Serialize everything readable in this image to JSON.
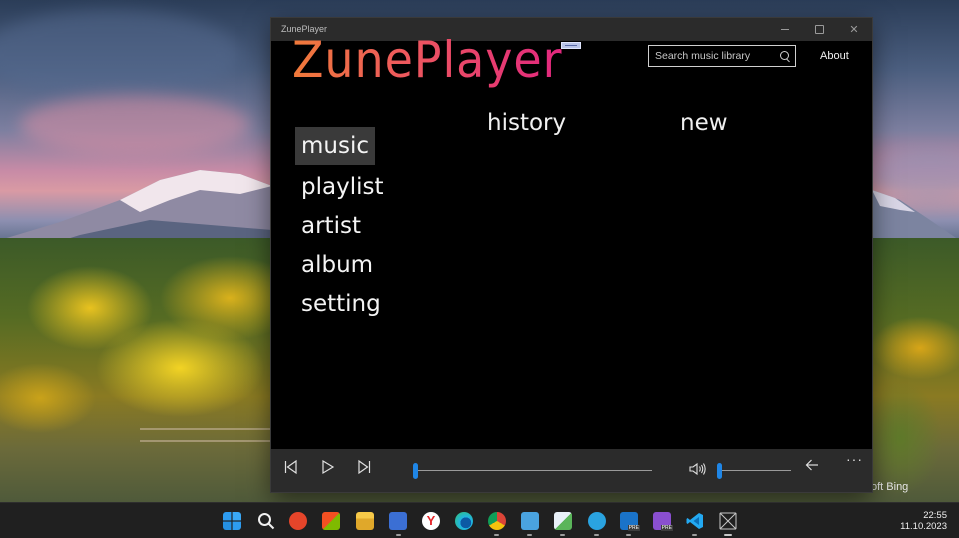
{
  "window": {
    "title": "ZunePlayer",
    "logo_text": "ZunePlayer"
  },
  "search": {
    "placeholder": "Search music library",
    "value": ""
  },
  "header": {
    "about_label": "About"
  },
  "nav": {
    "items": [
      {
        "label": "music",
        "selected": true
      },
      {
        "label": "playlist",
        "selected": false
      },
      {
        "label": "artist",
        "selected": false
      },
      {
        "label": "album",
        "selected": false
      },
      {
        "label": "setting",
        "selected": false
      }
    ]
  },
  "tabs": {
    "history_label": "history",
    "new_label": "new"
  },
  "player": {
    "position_fraction": 0.0,
    "volume_fraction": 0.0,
    "more_label": "···",
    "accent_color": "#1f86e6",
    "icons": [
      "previous-icon",
      "play-icon",
      "next-icon",
      "volume-icon",
      "back-arrow-icon",
      "more-icon"
    ]
  },
  "desktop": {
    "watermark_text": "oft Bing"
  },
  "taskbar": {
    "time": "22:55",
    "date": "11.10.2023",
    "apps": [
      "start-icon",
      "search-icon",
      "app-red-icon",
      "store-icon",
      "file-explorer-icon",
      "save-app-icon",
      "yandex-icon",
      "edge-icon",
      "chrome-icon",
      "notepad-icon",
      "image-editor-icon",
      "telegram-icon",
      "outlook-icon",
      "visual-studio-icon",
      "vscode-icon",
      "zuneplayer-icon"
    ],
    "badges": {
      "telegram": "",
      "outlook": "PRE",
      "visual_studio": "PRE"
    }
  }
}
